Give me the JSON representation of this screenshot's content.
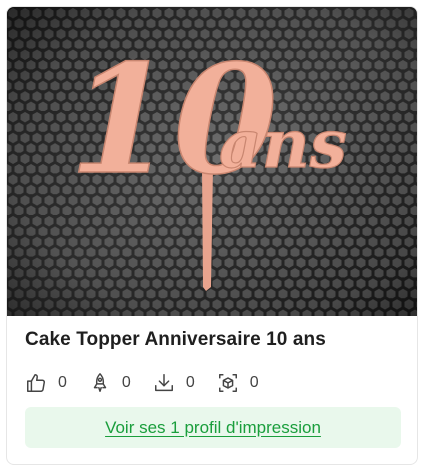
{
  "card": {
    "title": "Cake Topper Anniversaire 10 ans",
    "image": {
      "topper_text_number": "10",
      "topper_text_word": "ans",
      "topper_color": "#f2b09a",
      "background_color": "#2b2b2b"
    },
    "stats": {
      "likes": "0",
      "boosts": "0",
      "downloads": "0",
      "makes": "0"
    },
    "action_label": "Voir ses 1 profil d'impression",
    "colors": {
      "accent": "#1a9e3c",
      "action_bg": "#e9f8ec"
    }
  }
}
